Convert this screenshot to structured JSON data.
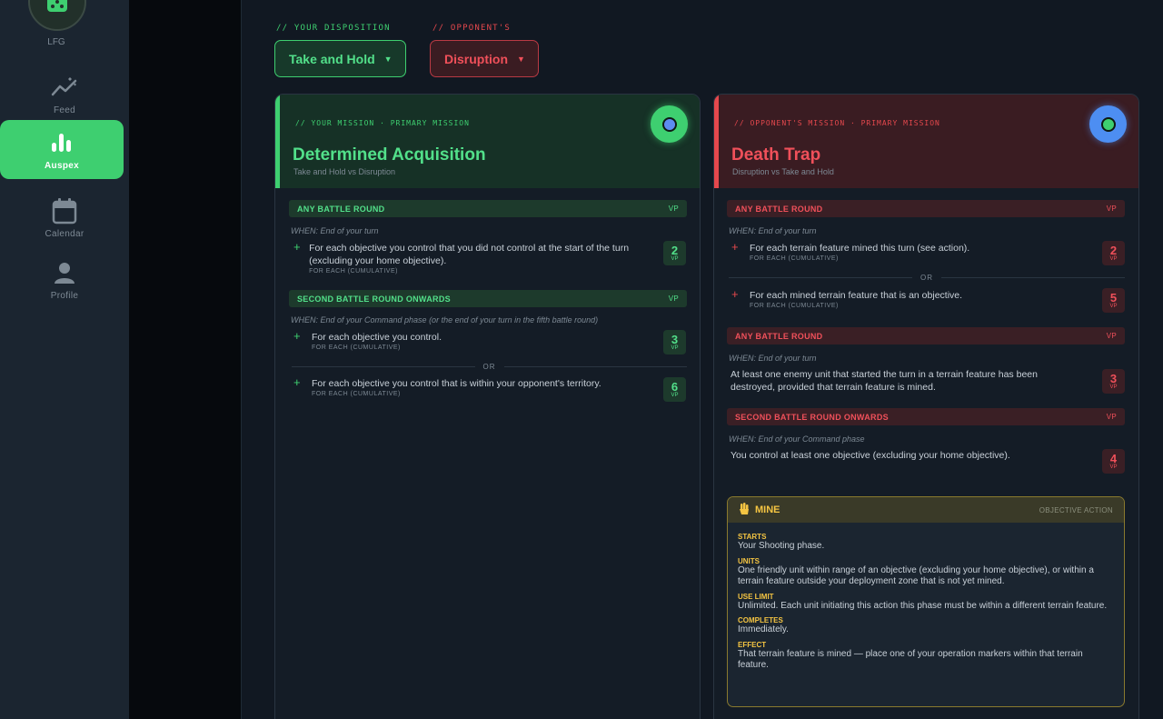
{
  "nav": {
    "lfg_label": "LFG",
    "items": [
      {
        "label": "Feed",
        "icon": "trending-up-icon"
      },
      {
        "label": "Auspex",
        "icon": "bar-chart-icon",
        "active": true
      },
      {
        "label": "Calendar",
        "icon": "calendar-icon"
      },
      {
        "label": "Profile",
        "icon": "profile-icon"
      }
    ]
  },
  "disposition": {
    "you_label": "// YOUR DISPOSITION",
    "opp_label": "// OPPONENT'S",
    "you_value": "Take and Hold",
    "opp_value": "Disruption"
  },
  "you": {
    "kicker": "// YOUR MISSION · PRIMARY MISSION",
    "title": "Determined Acquisition",
    "subtitle": "Take and Hold vs Disruption",
    "sections": [
      {
        "header": "ANY BATTLE ROUND",
        "vp": "VP",
        "when": "WHEN: End of your turn",
        "rows": [
          {
            "text": "For each objective you control that you did not control at the start of the turn (excluding your home objective).",
            "sub": "FOR EACH (CUMULATIVE)",
            "points": "2",
            "unit": "VP"
          }
        ]
      },
      {
        "header": "SECOND BATTLE ROUND ONWARDS",
        "vp": "VP",
        "when": "WHEN: End of your Command phase (or the end of your turn in the fifth battle round)",
        "rows": [
          {
            "text": "For each objective you control.",
            "sub": "FOR EACH (CUMULATIVE)",
            "points": "3",
            "unit": "VP"
          },
          {
            "text": "For each objective you control that is within your opponent's territory.",
            "sub": "FOR EACH (CUMULATIVE)",
            "points": "6",
            "unit": "VP"
          }
        ],
        "or": "OR"
      }
    ]
  },
  "opp": {
    "kicker": "// OPPONENT'S MISSION · PRIMARY MISSION",
    "title": "Death Trap",
    "subtitle": "Disruption vs Take and Hold",
    "sections": [
      {
        "header": "ANY BATTLE ROUND",
        "vp": "VP",
        "when": "WHEN: End of your turn",
        "rows": [
          {
            "text": "For each terrain feature mined this turn (see action).",
            "sub": "FOR EACH (CUMULATIVE)",
            "points": "2",
            "unit": "VP"
          },
          {
            "text": "For each mined terrain feature that is an objective.",
            "sub": "FOR EACH (CUMULATIVE)",
            "points": "5",
            "unit": "VP"
          }
        ],
        "or": "OR"
      },
      {
        "header": "ANY BATTLE ROUND",
        "vp": "VP",
        "when": "WHEN: End of your turn",
        "text": "At least one enemy unit that started the turn in a terrain feature has been destroyed, provided that terrain feature is mined.",
        "points": "3",
        "unit": "VP"
      },
      {
        "header": "SECOND BATTLE ROUND ONWARDS",
        "vp": "VP",
        "when": "WHEN: End of your Command phase",
        "text": "You control at least one objective (excluding your home objective).",
        "points": "4",
        "unit": "VP"
      }
    ],
    "action": {
      "title": "MINE",
      "tag": "OBJECTIVE ACTION",
      "icon": "hand-icon",
      "fields": [
        {
          "label": "STARTS",
          "value": "Your Shooting phase."
        },
        {
          "label": "UNITS",
          "value": "One friendly unit within range of an objective (excluding your home objective), or within a terrain feature outside your deployment zone that is not yet mined."
        },
        {
          "label": "USE LIMIT",
          "value": "Unlimited. Each unit initiating this action this phase must be within a different terrain feature."
        },
        {
          "label": "COMPLETES",
          "value": "Immediately."
        },
        {
          "label": "EFFECT",
          "value": "That terrain feature is mined — place one of your operation markers within that terrain feature."
        }
      ]
    }
  },
  "colors": {
    "accent_green": "#3ecf70",
    "accent_red": "#e5484d",
    "accent_gold": "#f5c542",
    "toggle_blue": "#4d8ef2"
  }
}
